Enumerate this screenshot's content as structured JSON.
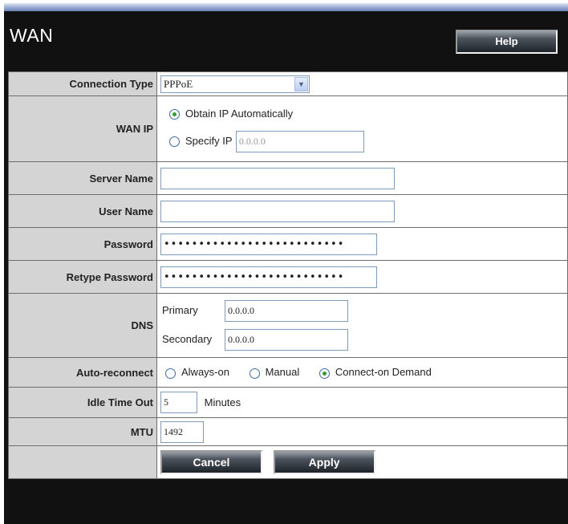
{
  "page": {
    "title": "WAN",
    "help_label": "Help"
  },
  "connection_type": {
    "label": "Connection Type",
    "value": "PPPoE"
  },
  "wan_ip": {
    "label": "WAN IP",
    "obtain_label": "Obtain IP Automatically",
    "specify_label": "Specify IP",
    "specify_value": "0.0.0.0",
    "selected": "obtain"
  },
  "server_name": {
    "label": "Server Name",
    "value": ""
  },
  "user_name": {
    "label": "User Name",
    "value": ""
  },
  "password": {
    "label": "Password",
    "value": "••••••••••••••••••••••••••"
  },
  "retype_password": {
    "label": "Retype Password",
    "value": "••••••••••••••••••••••••••"
  },
  "dns": {
    "label": "DNS",
    "primary_label": "Primary",
    "primary_value": "0.0.0.0",
    "secondary_label": "Secondary",
    "secondary_value": "0.0.0.0"
  },
  "auto_reconnect": {
    "label": "Auto-reconnect",
    "options": [
      "Always-on",
      "Manual",
      "Connect-on Demand"
    ],
    "selected": "Connect-on Demand"
  },
  "idle_timeout": {
    "label": "Idle Time Out",
    "value": "5",
    "unit": "Minutes"
  },
  "mtu": {
    "label": "MTU",
    "value": "1492"
  },
  "actions": {
    "cancel_label": "Cancel",
    "apply_label": "Apply"
  },
  "colors": {
    "header_bg": "#111111",
    "label_bg": "#d4d4d4",
    "radio_selected": "#2aa12e"
  }
}
